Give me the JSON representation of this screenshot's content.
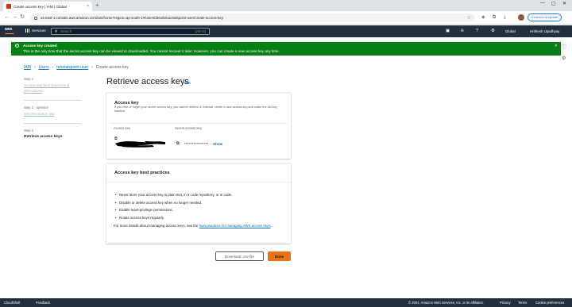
{
  "browser": {
    "tab_title": "Create access key | IAM | Global",
    "tab_close": "×",
    "new_tab": "+",
    "url": "us-east-1.console.aws.amazon.com/iam/home?region=ap-south-1#/users/details/tutorialspoint-user/create-access-key",
    "relaunch_label": "Relaunch to update"
  },
  "awsnav": {
    "logo": "aws",
    "services_label": "Services",
    "search_placeholder": "Search",
    "search_shortcut": "[Alt+S]",
    "region": "Global",
    "account": "Hrithesh Upadhyay"
  },
  "flash": {
    "title": "Access key created",
    "message": "This is the only time that the secret access key can be viewed or downloaded. You cannot recover it later. However, you can create a new access key any time."
  },
  "breadcrumb": {
    "items": [
      "IAM",
      "Users",
      "tutorialspoint-user"
    ],
    "current": "Create access key"
  },
  "steps": [
    {
      "label": "Step 1",
      "title": "Access key best practices & alternatives"
    },
    {
      "label": "Step 2 - optional",
      "title": "Set description tag"
    },
    {
      "label": "Step 3",
      "title": "Retrieve access keys"
    }
  ],
  "page": {
    "title": "Retrieve access keys",
    "info": "Info"
  },
  "access_key_panel": {
    "heading": "Access key",
    "description": "If you lose or forget your secret access key, you cannot retrieve it. Instead, create a new access key and make the old key inactive.",
    "col_access_key": "Access key",
    "col_secret": "Secret access key",
    "secret_masked": "****************",
    "show_label": "Show"
  },
  "best_practices": {
    "heading": "Access key best practices",
    "items": [
      "Never store your access key in plain text, in a code repository, or in code.",
      "Disable or delete access key when no longer needed.",
      "Enable least-privilege permissions.",
      "Rotate access keys regularly."
    ],
    "more_prefix": "For more details about managing access keys, see the ",
    "more_link": "best practices for managing AWS access keys",
    "more_suffix": "."
  },
  "actions": {
    "download": "Download .csv file",
    "done": "Done"
  },
  "footer": {
    "cloudshell": "CloudShell",
    "feedback": "Feedback",
    "copyright": "© 2024, Amazon Web Services, Inc. or its affiliates.",
    "privacy": "Privacy",
    "terms": "Terms",
    "cookies": "Cookie preferences"
  }
}
